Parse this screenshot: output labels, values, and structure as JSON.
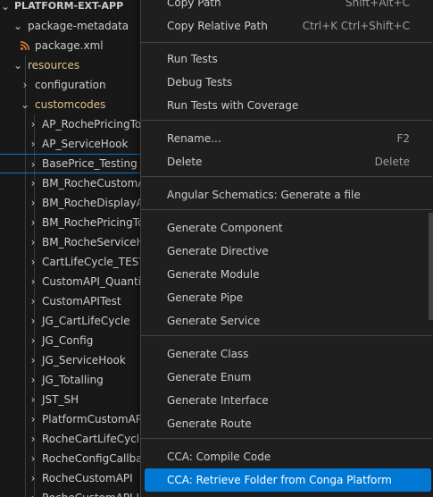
{
  "explorer": {
    "root_label": "PLATFORM-EXT-APP",
    "items": [
      {
        "label": "package-metadata"
      },
      {
        "label": "package.xml"
      },
      {
        "label": "resources"
      },
      {
        "label": "configuration"
      },
      {
        "label": "customcodes"
      },
      {
        "label": "AP_RochePricingTo"
      },
      {
        "label": "AP_ServiceHook"
      },
      {
        "label": "BasePrice_Testing"
      },
      {
        "label": "BM_RocheCustomA"
      },
      {
        "label": "BM_RocheDisplayA"
      },
      {
        "label": "BM_RochePricingTo"
      },
      {
        "label": "BM_RocheServiceH"
      },
      {
        "label": "CartLifeCycle_TEST"
      },
      {
        "label": "CustomAPI_Quanti"
      },
      {
        "label": "CustomAPITest"
      },
      {
        "label": "JG_CartLifeCycle"
      },
      {
        "label": "JG_Config"
      },
      {
        "label": "JG_ServiceHook"
      },
      {
        "label": "JG_Totalling"
      },
      {
        "label": "JST_SH"
      },
      {
        "label": "PlatformCustomAP"
      },
      {
        "label": "RocheCartLifeCycle"
      },
      {
        "label": "RocheConfigCallba"
      },
      {
        "label": "RocheCustomAPI"
      },
      {
        "label": "RocheCustomAPI I"
      }
    ]
  },
  "context_menu": {
    "items": [
      {
        "label": "Copy Path",
        "shortcut": "Shift+Alt+C"
      },
      {
        "label": "Copy Relative Path",
        "shortcut": "Ctrl+K Ctrl+Shift+C"
      },
      {
        "label": "Run Tests",
        "shortcut": ""
      },
      {
        "label": "Debug Tests",
        "shortcut": ""
      },
      {
        "label": "Run Tests with Coverage",
        "shortcut": ""
      },
      {
        "label": "Rename...",
        "shortcut": "F2"
      },
      {
        "label": "Delete",
        "shortcut": "Delete"
      },
      {
        "label": "Angular Schematics: Generate a file",
        "shortcut": ""
      },
      {
        "label": "Generate Component",
        "shortcut": ""
      },
      {
        "label": "Generate Directive",
        "shortcut": ""
      },
      {
        "label": "Generate Module",
        "shortcut": ""
      },
      {
        "label": "Generate Pipe",
        "shortcut": ""
      },
      {
        "label": "Generate Service",
        "shortcut": ""
      },
      {
        "label": "Generate Class",
        "shortcut": ""
      },
      {
        "label": "Generate Enum",
        "shortcut": ""
      },
      {
        "label": "Generate Interface",
        "shortcut": ""
      },
      {
        "label": "Generate Route",
        "shortcut": ""
      },
      {
        "label": "CCA: Compile Code",
        "shortcut": ""
      },
      {
        "label": "CCA: Retrieve Folder from Conga Platform",
        "shortcut": ""
      }
    ]
  },
  "colors": {
    "background": "#181818",
    "menu_background": "#1f1f1f",
    "accent": "#0078d4",
    "folder_highlight": "#e2c08d",
    "xml_icon": "#e37933"
  },
  "icons": {
    "expanded": "chevron-down-icon",
    "collapsed": "chevron-right-icon",
    "xml_file": "rss-icon"
  }
}
